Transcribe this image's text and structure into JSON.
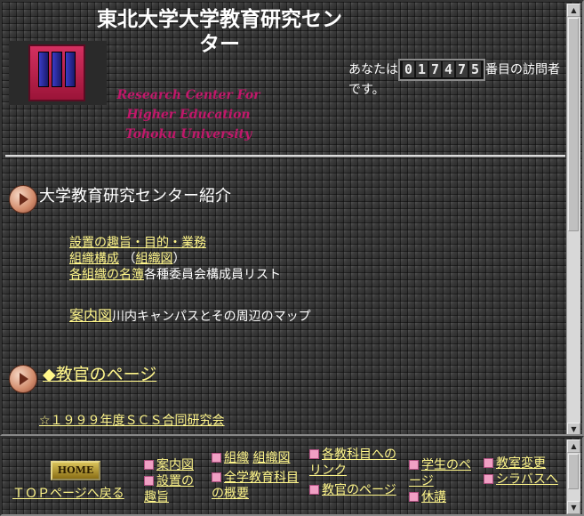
{
  "header": {
    "title": "東北大学大学教育研究センター",
    "subtitle": "Research Center For Higher Education Tohoku University",
    "visitor_prefix": "あなたは",
    "visitor_count_digits": [
      "0",
      "1",
      "7",
      "4",
      "7",
      "5"
    ],
    "visitor_suffix": "番目の訪問者です。"
  },
  "intro": {
    "heading": "大学教育研究センター紹介",
    "links": {
      "purpose": "設置の趣旨・目的・業務",
      "structure": "組織構成",
      "org_chart": "組織図",
      "roster": "各組織の名簿",
      "committee_text": "各種委員会構成員リスト",
      "campus_map": "案内図",
      "campus_map_desc": "川内キャンパスとその周辺のマップ"
    }
  },
  "faculty": {
    "heading": "◆教官のページ",
    "scs_link": "☆１９９９年度ＳＣＳ合同研究会"
  },
  "nav": {
    "home_button": "HOME",
    "back_to_top": "ＴＯＰページへ戻る",
    "items": {
      "map": "案内図",
      "purpose": "設置の趣旨",
      "org": "組織",
      "org_chart": "組織図",
      "all_univ": "全学教育科目の概要",
      "subjects": "各教科目へのリンク",
      "faculty": "教官のページ",
      "students": "学生のページ",
      "cancel": "休講",
      "room_change": "教室変更",
      "syllabus": "シラバスへ"
    }
  }
}
